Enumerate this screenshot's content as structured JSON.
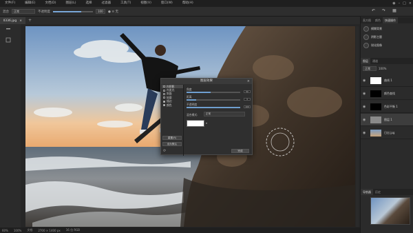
{
  "menu": [
    "文件(F)",
    "编辑(E)",
    "文档(D)",
    "图层(L)",
    "选择",
    "过滤器",
    "工具(T)",
    "视图(V)",
    "窗口(W)",
    "帮助(H)"
  ],
  "options": {
    "mode_label": "混合",
    "mode_value": "正常",
    "opacity_label": "不透明度",
    "opacity_fraction": 0.7,
    "value2": "100",
    "extra": "● ≡ 无"
  },
  "tab": {
    "name": "Ⅱ336.jpg",
    "close": "×",
    "add": "+"
  },
  "status": {
    "zoom": "60%",
    "fit": "100%",
    "doc": "文档",
    "size": "2700 × 1400 px",
    "profile": "16 位 RGB"
  },
  "right_panel": {
    "top_tabs": [
      "直方图",
      "颜色",
      "快速操作"
    ],
    "quick_actions": [
      "模糊背景",
      "阴影主题",
      "锐化图像"
    ],
    "layer_tabs": [
      "图层",
      "通道"
    ],
    "blend_value": "正常",
    "opacity": "100%",
    "layers": [
      {
        "name": "曲线 1"
      },
      {
        "name": "颜色查找"
      },
      {
        "name": "色彩平衡 1"
      },
      {
        "name": "图层 1"
      },
      {
        "name": "日出 jpg"
      }
    ],
    "nav_tabs": [
      "导航器",
      "历史"
    ]
  },
  "dialog": {
    "title": "图层效果",
    "effects": [
      {
        "label": "内阴影",
        "checked": false,
        "active": true
      },
      {
        "label": "内发光",
        "checked": false,
        "active": false
      },
      {
        "label": "斜面",
        "checked": false,
        "active": false
      },
      {
        "label": "轮廓",
        "checked": false,
        "active": false
      },
      {
        "label": "描边",
        "checked": true,
        "active": false
      },
      {
        "label": "颜色",
        "checked": true,
        "active": false
      }
    ],
    "reset_label": "重置(R)",
    "default_label": "设为默认",
    "sliders": [
      {
        "label": "角度",
        "value": "50",
        "fraction": 0.45
      },
      {
        "label": "距离",
        "value": "3",
        "fraction": 0.18
      },
      {
        "label": "不透明度",
        "value": "100",
        "fraction": 1.0
      }
    ],
    "blend_label": "混合模式:",
    "blend_value": "正常",
    "ok_label": "完成"
  }
}
